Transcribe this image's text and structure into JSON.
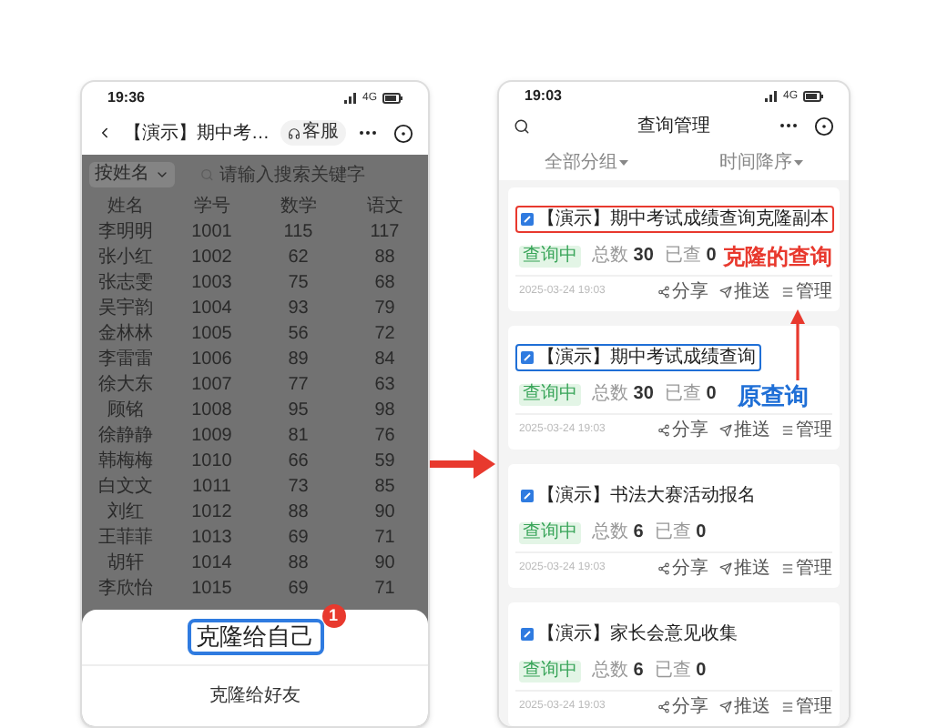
{
  "left_phone": {
    "status_time": "19:36",
    "network": "4G",
    "nav_title": "【演示】期中考…",
    "service_button": "客服",
    "filter": "按姓名",
    "search_placeholder": "请输入搜索关键字",
    "columns": [
      "姓名",
      "学号",
      "数学",
      "语文"
    ],
    "rows": [
      [
        "李明明",
        "1001",
        "115",
        "117"
      ],
      [
        "张小红",
        "1002",
        "62",
        "88"
      ],
      [
        "张志雯",
        "1003",
        "75",
        "68"
      ],
      [
        "吴宇韵",
        "1004",
        "93",
        "79"
      ],
      [
        "金林林",
        "1005",
        "56",
        "72"
      ],
      [
        "李雷雷",
        "1006",
        "89",
        "84"
      ],
      [
        "徐大东",
        "1007",
        "77",
        "63"
      ],
      [
        "顾铭",
        "1008",
        "95",
        "98"
      ],
      [
        "徐静静",
        "1009",
        "81",
        "76"
      ],
      [
        "韩梅梅",
        "1010",
        "66",
        "59"
      ],
      [
        "白文文",
        "1011",
        "73",
        "85"
      ],
      [
        "刘红",
        "1012",
        "88",
        "90"
      ],
      [
        "王菲菲",
        "1013",
        "69",
        "71"
      ],
      [
        "胡轩",
        "1014",
        "88",
        "90"
      ],
      [
        "李欣怡",
        "1015",
        "69",
        "71"
      ]
    ],
    "sheet": {
      "badge": "1",
      "items": [
        {
          "label": "克隆给自己",
          "highlighted": true
        },
        {
          "label": "克隆给好友",
          "highlighted": false
        }
      ]
    }
  },
  "right_phone": {
    "status_time": "19:03",
    "network": "4G",
    "title": "查询管理",
    "filters": [
      "全部分组",
      "时间降序"
    ],
    "cards": [
      {
        "title": "【演示】期中考试成绩查询克隆副本",
        "outlined": true,
        "color": "#e8392e",
        "status": "查询中",
        "total_label": "总数",
        "total": "30",
        "queried_label": "已查",
        "queried": "0",
        "date": "2025-03-24 19:03",
        "actions": [
          "分享",
          "推送",
          "管理"
        ]
      },
      {
        "title": "【演示】期中考试成绩查询",
        "outlined": true,
        "color": "#1f6fd6",
        "status": "查询中",
        "total_label": "总数",
        "total": "30",
        "queried_label": "已查",
        "queried": "0",
        "date": "2025-03-24 19:03",
        "actions": [
          "分享",
          "推送",
          "管理"
        ]
      },
      {
        "title": "【演示】书法大赛活动报名",
        "outlined": false,
        "status": "查询中",
        "total_label": "总数",
        "total": "6",
        "queried_label": "已查",
        "queried": "0",
        "date": "2025-03-24 19:03",
        "actions": [
          "分享",
          "推送",
          "管理"
        ]
      },
      {
        "title": "【演示】家长会意见收集",
        "outlined": false,
        "status": "查询中",
        "total_label": "总数",
        "total": "6",
        "queried_label": "已查",
        "queried": "0",
        "date": "2025-03-24 19:03",
        "actions": [
          "分享",
          "推送",
          "管理"
        ]
      }
    ]
  },
  "annotations": [
    {
      "text": "克隆的查询",
      "color": "#e8392e"
    },
    {
      "text": "原查询",
      "color": "#1f6fd6"
    }
  ]
}
